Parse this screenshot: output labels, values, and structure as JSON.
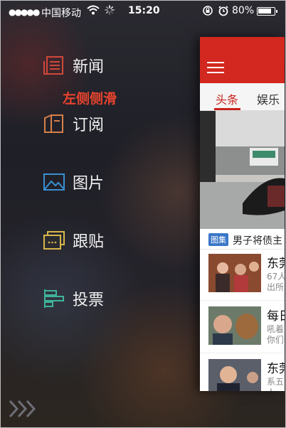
{
  "status_bar": {
    "signal": "●●●●●",
    "carrier": "中国移动",
    "time": "15:20",
    "battery": "80%"
  },
  "menu": {
    "items": [
      {
        "label": "新闻",
        "icon": "news-icon",
        "color": "#d0473b"
      },
      {
        "label": "订阅",
        "icon": "subscribe-icon",
        "color": "#d8804a"
      },
      {
        "label": "图片",
        "icon": "picture-icon",
        "color": "#3b8fd1"
      },
      {
        "label": "跟贴",
        "icon": "comments-icon",
        "color": "#d9b64a"
      },
      {
        "label": "投票",
        "icon": "vote-icon",
        "color": "#3fb39a"
      }
    ]
  },
  "annotation": "左侧侧滑",
  "news_panel": {
    "accent": "#d3281f",
    "tabs": [
      "头条",
      "娱乐"
    ],
    "hero_caption": {
      "badge": "图集",
      "text": "男子将债主"
    },
    "rows": [
      {
        "title": "东莞",
        "lines": [
          "67人",
          "出所"
        ]
      },
      {
        "title": "每日",
        "lines": [
          "吼着",
          "你们"
        ]
      },
      {
        "title": "东莞",
        "lines": [
          "系五",
          "人"
        ]
      }
    ]
  }
}
